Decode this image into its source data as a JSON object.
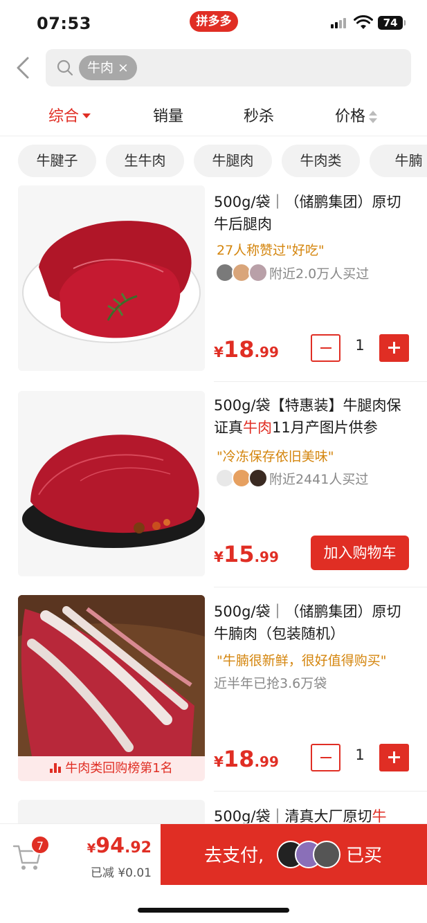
{
  "status": {
    "time": "07:53",
    "app_badge": "拼多多",
    "battery": "74"
  },
  "search": {
    "query_chip": "牛肉 ×"
  },
  "sort_tabs": [
    {
      "label": "综合"
    },
    {
      "label": "销量"
    },
    {
      "label": "秒杀"
    },
    {
      "label": "价格"
    }
  ],
  "filter_chips": [
    "牛腱子",
    "生牛肉",
    "牛腿肉",
    "牛肉类",
    "牛腩"
  ],
  "products": [
    {
      "title": "500g/袋｜（储鹏集团）原切牛后腿肉",
      "quote": "27人称赞过\"好吃\"",
      "buyers": "附近2.0万人买过",
      "price_cur": "¥",
      "price_int": "18",
      "price_dec": ".99",
      "qty": "1"
    },
    {
      "title_pre": "500g/袋【特惠装】牛腿肉保证真",
      "title_hl": "牛肉",
      "title_post": "11月产图片供参",
      "quote": "\"冷冻保存依旧美味\"",
      "buyers": "附近2441人买过",
      "price_cur": "¥",
      "price_int": "15",
      "price_dec": ".99",
      "cart_label": "加入购物车"
    },
    {
      "title": "500g/袋｜（储鹏集团）原切牛腩肉（包装随机）",
      "quote": "\"牛腩很新鲜，很好值得购买\"",
      "sold": "近半年已抢3.6万袋",
      "price_cur": "¥",
      "price_int": "18",
      "price_dec": ".99",
      "qty": "1",
      "rank": "牛肉类回购榜第1名"
    },
    {
      "title_pre": "500g/袋｜清真大厂原切",
      "title_hl": "牛"
    }
  ],
  "bottom": {
    "cart_count": "7",
    "total_cur": "¥",
    "total_int": "94",
    "total_dec": ".92",
    "discount": "已减 ¥0.01",
    "pay_label": "去支付,",
    "pay_suffix": "已买"
  },
  "colors": {
    "brand_red": "#e02e24",
    "quote_orange": "#d4850d"
  }
}
